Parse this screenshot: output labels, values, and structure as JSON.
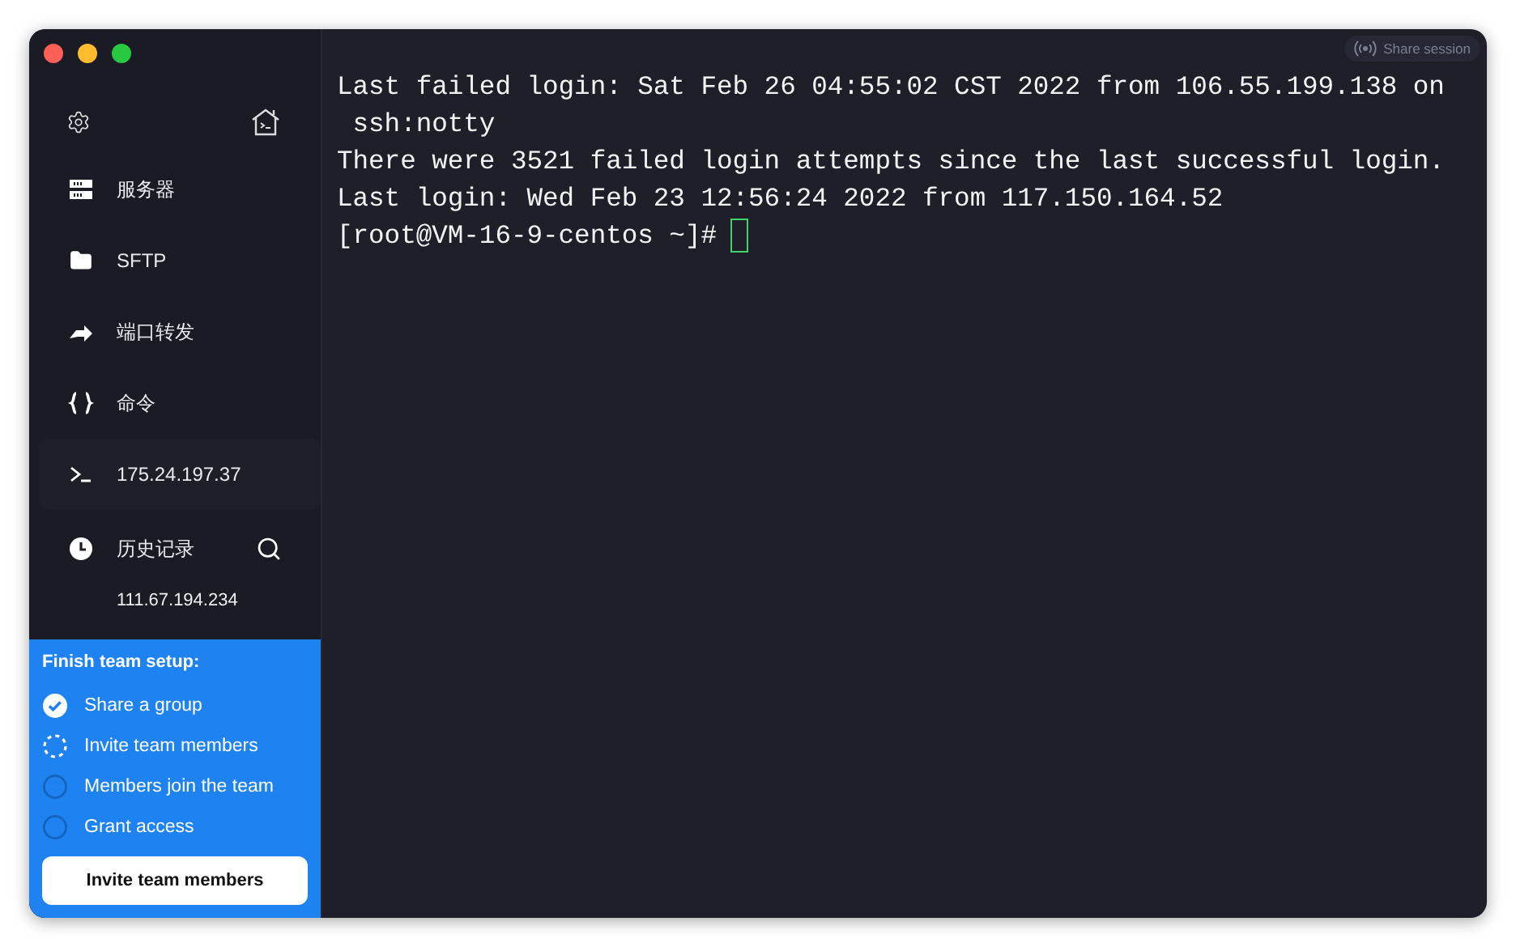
{
  "share_session": {
    "label": "Share session"
  },
  "sidebar": {
    "items": [
      {
        "kind": "server",
        "label": "服务器",
        "selected": false
      },
      {
        "kind": "folder",
        "label": "SFTP",
        "selected": false
      },
      {
        "kind": "forward",
        "label": "端口转发",
        "selected": false
      },
      {
        "kind": "braces",
        "label": "命令",
        "selected": false
      },
      {
        "kind": "terminal",
        "label": "175.24.197.37",
        "selected": true
      }
    ],
    "history": {
      "label": "历史记录",
      "entries": [
        "111.67.194.234"
      ]
    }
  },
  "team_setup": {
    "title": "Finish team setup:",
    "steps": [
      {
        "label": "Share a group",
        "kind": "done"
      },
      {
        "label": "Invite team members",
        "kind": "in_progress"
      },
      {
        "label": "Members join the team",
        "kind": "pending"
      },
      {
        "label": "Grant access",
        "kind": "pending"
      }
    ],
    "button": "Invite team members"
  },
  "terminal": {
    "lines": [
      "Last failed login: Sat Feb 26 04:55:02 CST 2022 from 106.55.199.138 on",
      " ssh:notty",
      "There were 3521 failed login attempts since the last successful login.",
      "Last login: Wed Feb 23 12:56:24 2022 from 117.150.164.52"
    ],
    "prompt": "[root@VM-16-9-centos ~]#"
  }
}
